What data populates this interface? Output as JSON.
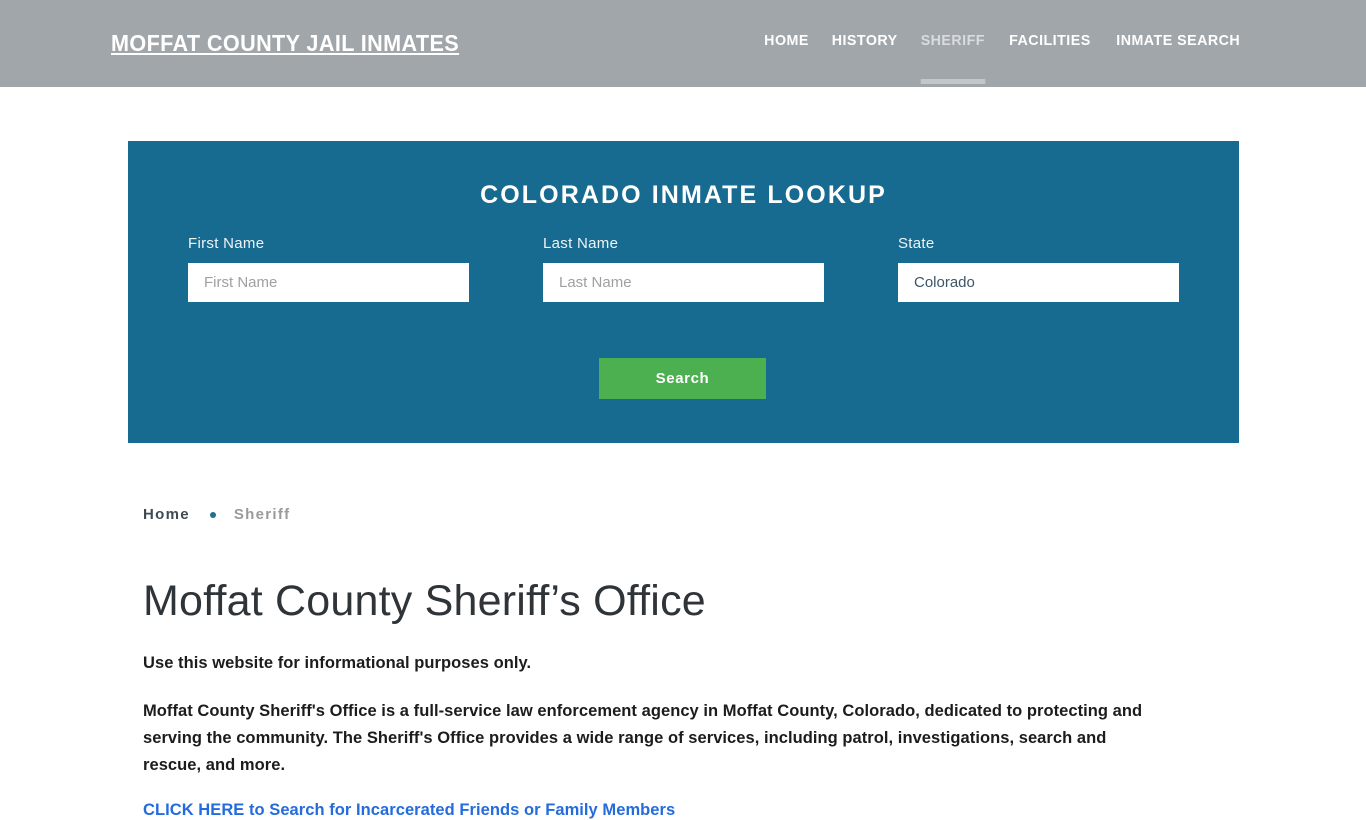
{
  "header": {
    "brand": "Moffat County Jail Inmates",
    "brand_color": "#ffffff",
    "background_color": "#a1a6aa",
    "nav": [
      {
        "label": "HOME",
        "active": false
      },
      {
        "label": "HISTORY",
        "active": false
      },
      {
        "label": "SHERIFF",
        "active": true
      },
      {
        "label": "FACILITIES",
        "active": false
      },
      {
        "label": "INMATE SEARCH",
        "active": false
      }
    ]
  },
  "lookup": {
    "title": "COLORADO INMATE LOOKUP",
    "background_color": "#186b90",
    "first_name": {
      "label": "First Name",
      "placeholder": "First Name",
      "value": ""
    },
    "last_name": {
      "label": "Last Name",
      "placeholder": "Last Name",
      "value": ""
    },
    "state": {
      "label": "State",
      "selected": "Colorado",
      "options": [
        "Colorado"
      ]
    },
    "search_button": {
      "label": "Search",
      "color": "#4caf50"
    }
  },
  "breadcrumb": {
    "home_label": "Home",
    "separator": "•",
    "current_label": "Sheriff",
    "bullet_color": "#1f7091"
  },
  "main": {
    "page_title": "Moffat County Sheriff’s Office",
    "notice": "Use this website for informational purposes only.",
    "description": "Moffat County Sheriff's Office is a full-service law enforcement agency in Moffat County, Colorado, dedicated to protecting and serving the community. The Sheriff's Office provides a wide range of services, including patrol, investigations, search and rescue, and more.",
    "cta_link": {
      "label": "CLICK HERE to Search for Incarcerated Friends or Family Members",
      "color": "#246bdd"
    }
  }
}
